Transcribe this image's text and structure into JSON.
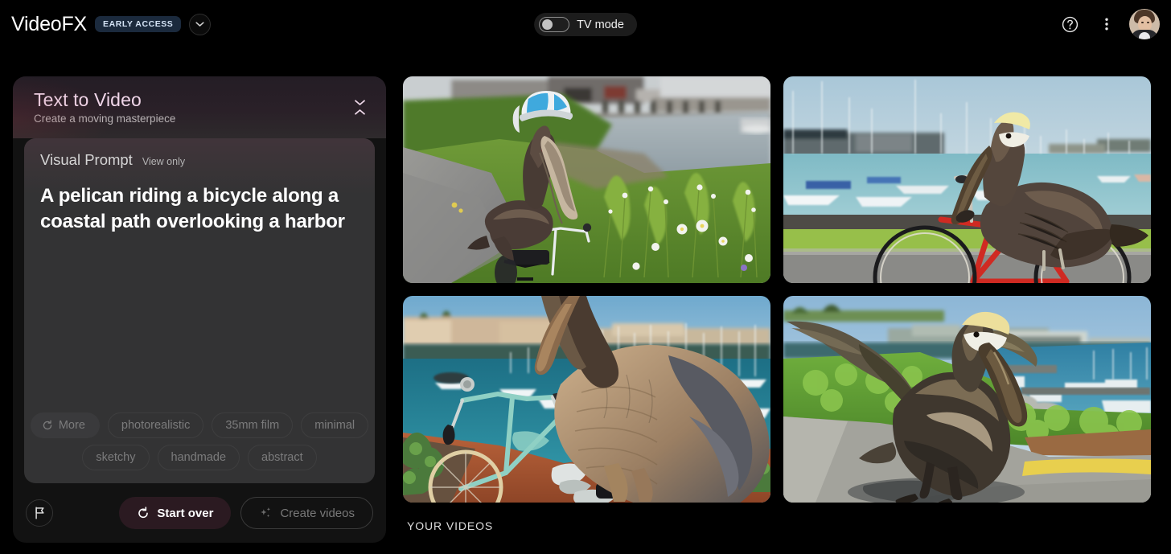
{
  "app": {
    "brand": "VideoFX",
    "early_access_badge": "EARLY ACCESS",
    "brand_dropdown_icon": "chevron-down-icon"
  },
  "topbar": {
    "tv_mode_label": "TV mode",
    "tv_mode_on": false,
    "help_icon": "help-circle-icon",
    "overflow_icon": "more-vertical-icon",
    "avatar_alt": "user-avatar"
  },
  "panel": {
    "title": "Text to Video",
    "subtitle": "Create a moving masterpiece",
    "expander_icons": [
      "chevron-down-icon",
      "chevron-up-icon"
    ],
    "prompt": {
      "label": "Visual Prompt",
      "status": "View only",
      "text": "A pelican riding a bicycle along a coastal path overlooking a harbor"
    },
    "chips": {
      "more_label": "More",
      "more_icon": "refresh-icon",
      "row1": [
        "photorealistic",
        "35mm film",
        "minimal"
      ],
      "row2": [
        "sketchy",
        "handmade",
        "abstract"
      ]
    },
    "footer": {
      "report_icon": "flag-icon",
      "start_over_label": "Start over",
      "start_over_icon": "restart-icon",
      "create_videos_label": "Create videos",
      "create_videos_icon": "sparkle-icon",
      "create_videos_disabled": true
    }
  },
  "videos": {
    "section_label": "YOUR VIDEOS",
    "items": [
      {
        "alt": "Pelican wearing a blue helmet perched on a white bicycle on a gravel coastal path with daisies and a harbor behind"
      },
      {
        "alt": "Pelican standing on a red cruiser bicycle in front of a marina full of sailboats"
      },
      {
        "alt": "Close-up of a pelican on red dirt beside a teal bicycle overlooking a turquoise harbor"
      },
      {
        "alt": "Pelican with wings spread walking on a paved coastal path above a harbor"
      }
    ]
  },
  "colors": {
    "background": "#000000",
    "panel": "#121212",
    "prompt_card": "#333334",
    "title_accent": "#f1d7ea",
    "badge_bg": "#1b2a3d",
    "start_over_bg": "#2b1a21"
  }
}
